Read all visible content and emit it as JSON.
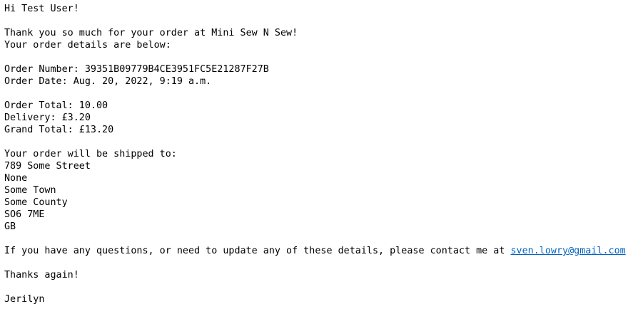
{
  "email": {
    "greeting": "Hi Test User!",
    "thanks_line": "Thank you so much for your order at Mini Sew N Sew!",
    "details_intro": "Your order details are below:",
    "order_number": "Order Number: 39351B09779B4CE3951FC5E21287F27B",
    "order_date": "Order Date: Aug. 20, 2022, 9:19 a.m.",
    "order_total": "Order Total: 10.00",
    "delivery": "Delivery: £3.20",
    "grand_total": "Grand Total: £13.20",
    "ship_intro": "Your order will be shipped to:",
    "address": {
      "line1": "789 Some Street",
      "line2": "None",
      "town": "Some Town",
      "county": "Some County",
      "postcode": "SO6 7ME",
      "country": "GB"
    },
    "contact_text": "If you have any questions, or need to update any of these details, please contact me at ",
    "contact_email": "sven.lowry@gmail.com",
    "thanks_again": "Thanks again!",
    "signature": "Jerilyn"
  },
  "colors": {
    "text": "#000000",
    "link": "#0563c1",
    "background": "#ffffff"
  }
}
